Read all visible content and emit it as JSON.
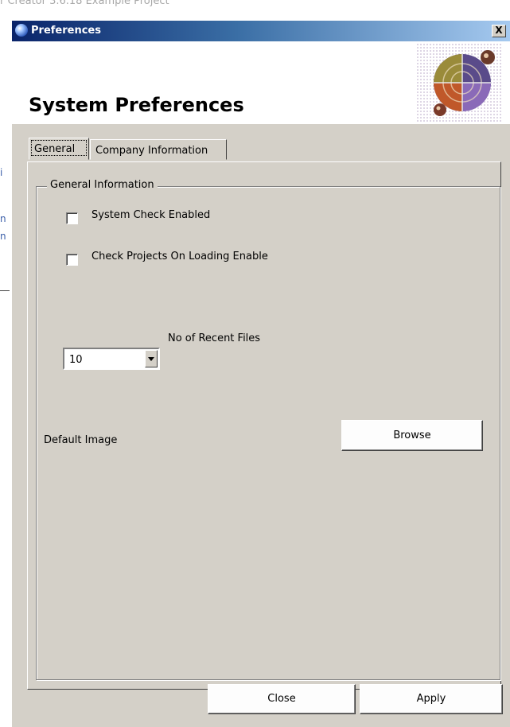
{
  "background": {
    "title_fragment": "r Creator   3.6.18     Example Project"
  },
  "window": {
    "title": "Preferences",
    "close_glyph": "X"
  },
  "header": {
    "heading": "System Preferences"
  },
  "tabs": [
    {
      "label": "General",
      "active": true
    },
    {
      "label": "Company Information",
      "active": false
    }
  ],
  "general": {
    "group_title": "General Information",
    "system_check_label": "System Check Enabled",
    "system_check_checked": false,
    "check_projects_label": "Check Projects On Loading Enable",
    "check_projects_checked": false,
    "recent_files_value": "10",
    "recent_files_label": "No of Recent Files",
    "default_image_label": "Default Image",
    "browse_label": "Browse"
  },
  "footer": {
    "close_label": "Close",
    "apply_label": "Apply"
  },
  "colors": {
    "dialog_face": "#d4d0c8",
    "titlebar_start": "#0a246a",
    "titlebar_end": "#a6caf0"
  }
}
